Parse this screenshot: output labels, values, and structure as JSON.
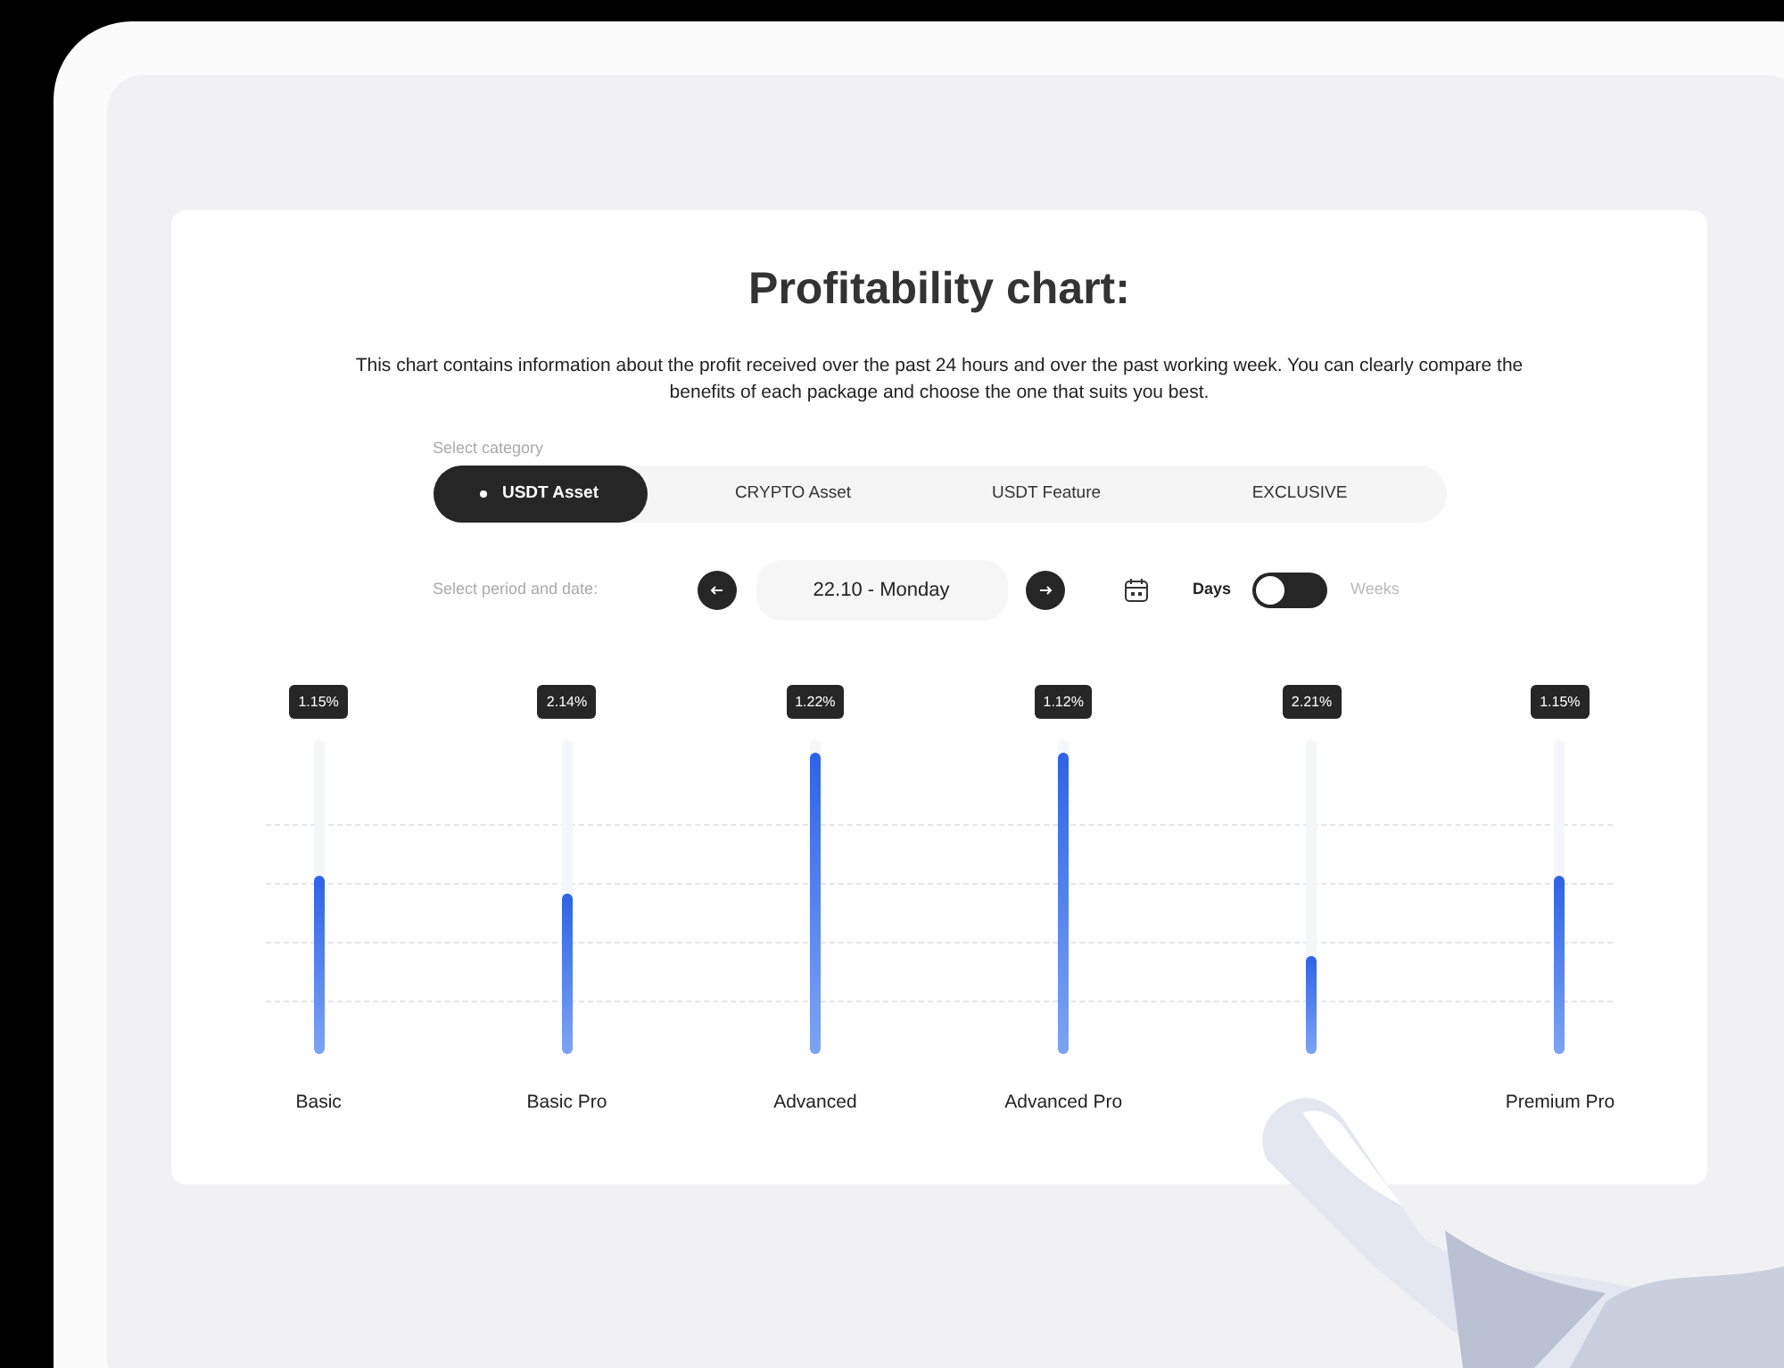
{
  "title": "Profitability chart:",
  "description": "This chart contains information about the profit received over the past 24 hours and over the past working week. You can clearly compare the benefits of each package and choose the one that suits you best.",
  "category": {
    "label": "Select category",
    "tabs": [
      {
        "label": "USDT Asset",
        "selected": true
      },
      {
        "label": "CRYPTO Asset",
        "selected": false
      },
      {
        "label": "USDT Feature",
        "selected": false
      },
      {
        "label": "EXCLUSIVE",
        "selected": false
      }
    ]
  },
  "period": {
    "label": "Select period and date:",
    "date": "22.10 - Monday",
    "toggle": {
      "left": "Days",
      "right": "Weeks",
      "on": false
    }
  },
  "packages": [
    {
      "badge": "1.15%",
      "level": 0.57,
      "name": "Basic"
    },
    {
      "badge": "2.14%",
      "level": 0.51,
      "name": "Basic Pro"
    },
    {
      "badge": "1.22%",
      "level": 0.96,
      "name": "Advanced"
    },
    {
      "badge": "1.12%",
      "level": 0.96,
      "name": "Advanced Pro"
    },
    {
      "badge": "2.21%",
      "level": 0.31
    },
    {
      "badge": "1.15%",
      "level": 0.57,
      "name": "Premium Pro"
    }
  ]
}
